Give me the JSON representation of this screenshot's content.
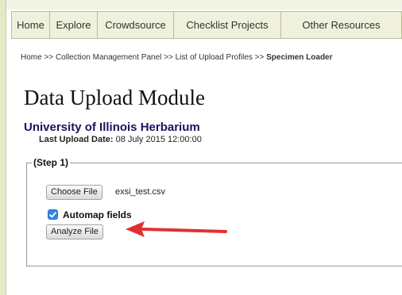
{
  "nav": {
    "items": [
      {
        "label": "Home"
      },
      {
        "label": "Explore"
      },
      {
        "label": "Crowdsource"
      },
      {
        "label": "Checklist Projects"
      },
      {
        "label": "Other Resources"
      }
    ]
  },
  "breadcrumb": {
    "items": [
      "Home",
      "Collection Management Panel",
      "List of Upload Profiles"
    ],
    "separator": ">>",
    "current": "Specimen Loader"
  },
  "page": {
    "title": "Data Upload Module",
    "collection_name": "University of Illinois Herbarium",
    "last_upload_label": "Last Upload Date:",
    "last_upload_value": "08 July 2015 12:00:00"
  },
  "step": {
    "legend": "(Step 1)",
    "choose_file_label": "Choose File",
    "file_name": "exsi_test.csv",
    "automap_label": "Automap fields",
    "automap_checked": true,
    "analyze_label": "Analyze File"
  },
  "colors": {
    "nav_background": "#eff1dd",
    "collection_name": "#16165f",
    "checkbox_accent": "#2f86e6",
    "annotation_arrow": "#e03131"
  },
  "icons": {
    "checkbox": "checkmark-icon",
    "annotation": "red-arrow-icon"
  }
}
